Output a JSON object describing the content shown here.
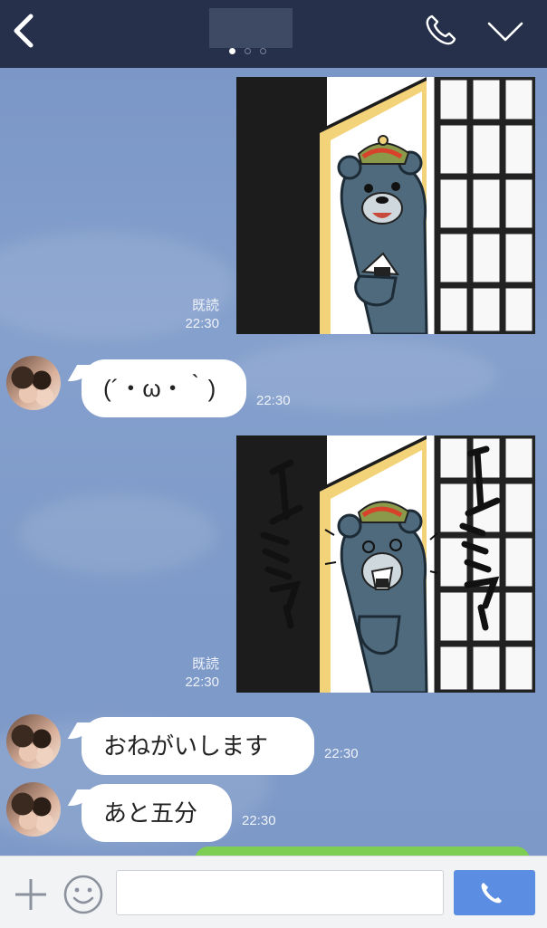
{
  "header": {
    "back_icon": "chevron-left-icon",
    "call_icon": "phone-icon",
    "menu_icon": "chevron-down-icon",
    "page_dots": 3,
    "active_dot": 0
  },
  "messages": [
    {
      "type": "sticker",
      "side": "right",
      "read_label": "既読",
      "time": "22:30"
    },
    {
      "type": "text",
      "side": "left",
      "text": "(´・ω・｀)",
      "time": "22:30"
    },
    {
      "type": "sticker",
      "side": "right",
      "read_label": "既読",
      "time": "22:30",
      "sticker_text": [
        "ムシャァ",
        "ムシャァ"
      ]
    },
    {
      "type": "text",
      "side": "left",
      "text": "おねがいします",
      "time": "22:30"
    },
    {
      "type": "text",
      "side": "left",
      "text": "あと五分",
      "time": "22:30"
    }
  ],
  "input_bar": {
    "plus_icon": "plus-icon",
    "emoji_icon": "smiley-icon",
    "input_value": "",
    "send_icon": "phone-icon"
  },
  "colors": {
    "header_bg": "#26304a",
    "chat_bg": "#7e9ac7",
    "send_button": "#5b8de3",
    "own_bubble": "#7fce54"
  }
}
